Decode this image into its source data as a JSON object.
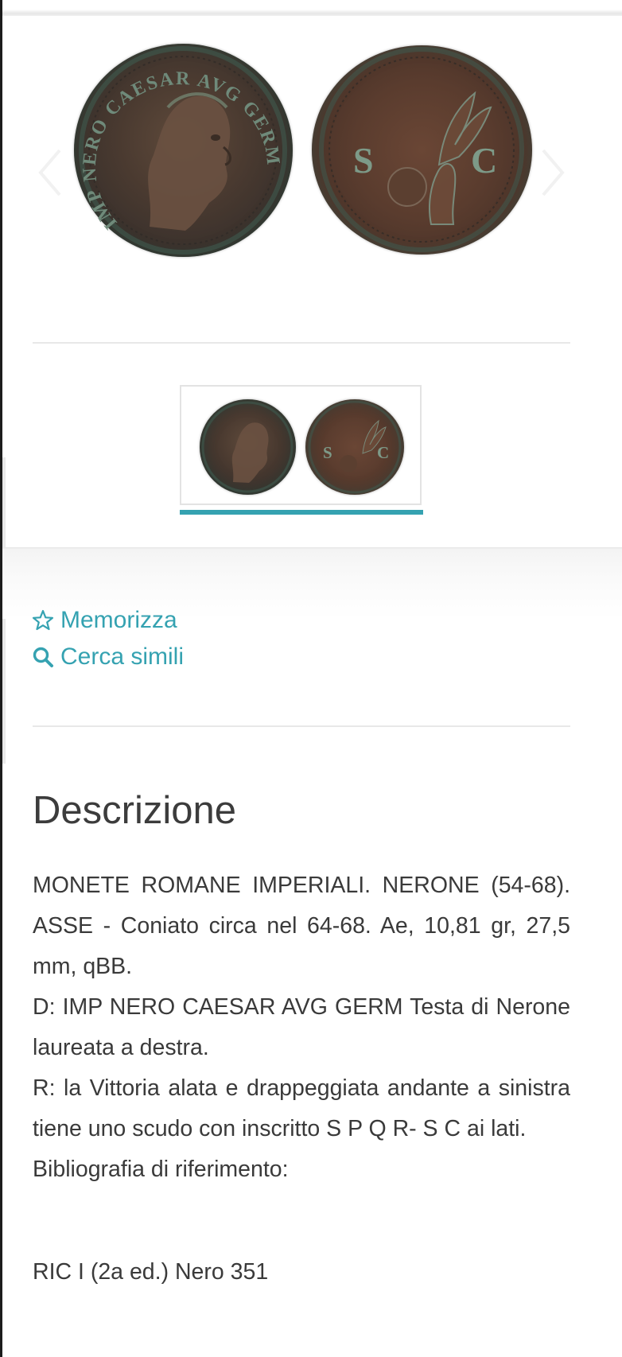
{
  "gallery": {
    "prev_label": "‹",
    "next_label": "›",
    "obverse_image": "obverse-coin-image",
    "reverse_image": "reverse-coin-image",
    "obverse_legend": "IMP NERO CAESAR AVG GERM",
    "reverse_letters": [
      "S",
      "C"
    ]
  },
  "thumbnail": {
    "image": "coin-thumbnail"
  },
  "actions": {
    "memorizza": {
      "icon": "star-icon",
      "label": "Memorizza"
    },
    "cerca_simili": {
      "icon": "search-icon",
      "label": "Cerca simili"
    }
  },
  "colors": {
    "accent": "#35a2b1",
    "text": "#3a3a3a",
    "divider": "#e8e8e8"
  },
  "description": {
    "title": "Descrizione",
    "line1": "MONETE ROMANE IMPERIALI. NERONE (54-68). ASSE - Coniato circa nel 64-68. Ae, 10,81 gr, 27,5 mm, qBB.",
    "line2": "D: IMP NERO CAESAR AVG GERM Testa di Nerone laureata a destra.",
    "line3": "R: la Vittoria alata e drappeggiata andante a sinistra tiene uno scudo con inscritto S P Q R- S C ai lati.",
    "line4": "Bibliografia di riferimento:",
    "reference": "RIC I (2a ed.) Nero 351"
  }
}
